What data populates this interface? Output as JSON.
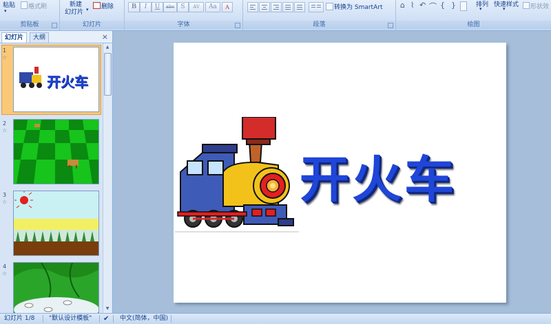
{
  "ribbon": {
    "clipboard": {
      "label": "剪贴板",
      "paste": "粘贴",
      "format_painter": "格式刷"
    },
    "slides": {
      "label": "幻灯片",
      "new_line1": "新建",
      "new_line2": "幻灯片",
      "delete": "删除"
    },
    "font": {
      "label": "字体",
      "buttons": [
        "B",
        "I",
        "U",
        "abc",
        "S",
        "AV",
        "Aa"
      ]
    },
    "paragraph": {
      "label": "段落",
      "smartart": "转换为 SmartArt"
    },
    "drawing": {
      "label": "绘图",
      "arrange": "排列",
      "quick_styles": "快速样式",
      "shape_outline": "形状效",
      "glyphs": [
        "⌂",
        "⌇",
        "↶",
        "⌒",
        "{",
        "}"
      ]
    }
  },
  "leftpanel": {
    "tabs": [
      "幻灯片",
      "大纲"
    ],
    "close": "×",
    "thumbnails": [
      {
        "num": "1",
        "title": "开火车"
      },
      {
        "num": "2"
      },
      {
        "num": "3"
      },
      {
        "num": "4"
      }
    ],
    "star": "☆"
  },
  "slide": {
    "title": "开火车"
  },
  "statusbar": {
    "slide_info": "幻灯片 1/8",
    "theme": "\"默认设计模板\"",
    "language": "中文(简体，中国)"
  },
  "colors": {
    "title_blue": "#1f46d8",
    "selected_thumb": "#fbc878",
    "ribbon_bg": "#d3e2f6",
    "edit_bg": "#a6bed9"
  }
}
